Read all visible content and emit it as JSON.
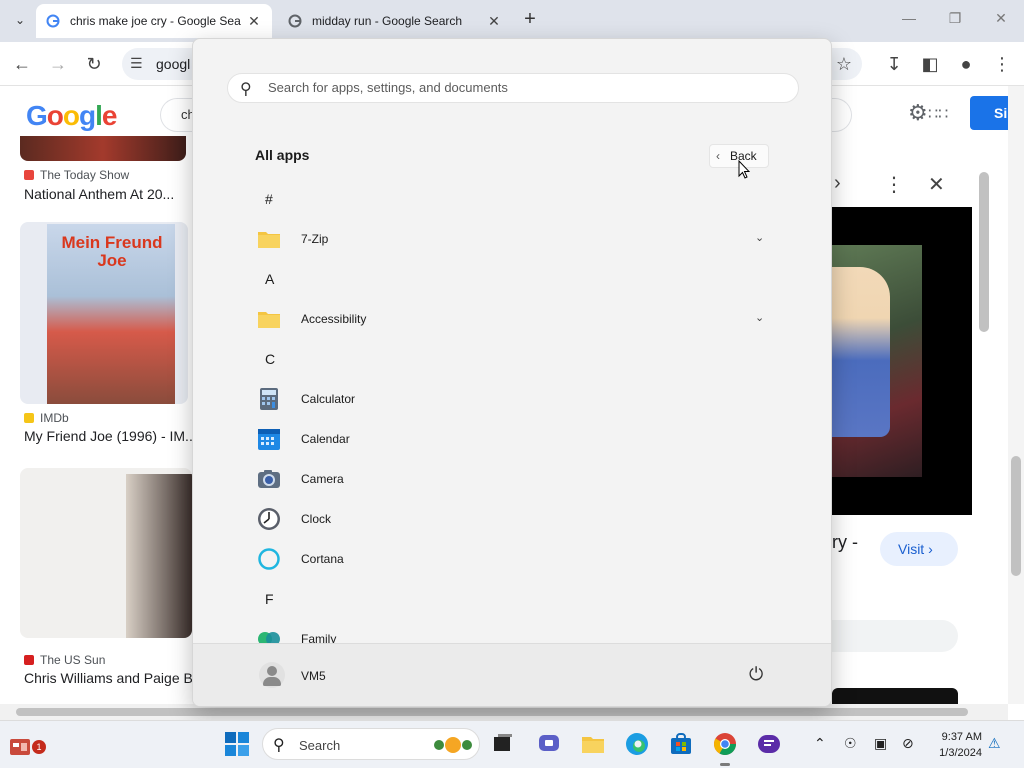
{
  "browser": {
    "tabs": [
      {
        "title": "chris make joe cry - Google Sea",
        "active": true
      },
      {
        "title": "midday run - Google Search",
        "active": false
      }
    ],
    "omnibox_text": "googl"
  },
  "google": {
    "logo": "Google",
    "query_visible": "ch",
    "signin_label": "Si",
    "results": [
      {
        "source": "The Today Show",
        "title": "National Anthem At 20..."
      },
      {
        "source": "IMDb",
        "title": "My Friend Joe (1996) - IM..."
      },
      {
        "source": "The US Sun",
        "title": "Chris Williams and Paige B"
      }
    ],
    "poster_text": "Mein Freund Joe",
    "panel_text": "ry -",
    "visit_label": "Visit"
  },
  "start_menu": {
    "search_placeholder": "Search for apps, settings, and documents",
    "title": "All apps",
    "back_label": "Back",
    "user_name": "VM5",
    "list": [
      {
        "kind": "letter",
        "label": "#"
      },
      {
        "kind": "app",
        "label": "7-Zip",
        "icon": "folder-icon",
        "expandable": true
      },
      {
        "kind": "letter",
        "label": "A"
      },
      {
        "kind": "app",
        "label": "Accessibility",
        "icon": "folder-icon",
        "expandable": true
      },
      {
        "kind": "letter",
        "label": "C"
      },
      {
        "kind": "app",
        "label": "Calculator",
        "icon": "calculator-icon"
      },
      {
        "kind": "app",
        "label": "Calendar",
        "icon": "calendar-icon"
      },
      {
        "kind": "app",
        "label": "Camera",
        "icon": "camera-icon"
      },
      {
        "kind": "app",
        "label": "Clock",
        "icon": "clock-icon"
      },
      {
        "kind": "app",
        "label": "Cortana",
        "icon": "cortana-icon"
      },
      {
        "kind": "letter",
        "label": "F"
      },
      {
        "kind": "app",
        "label": "Family",
        "icon": "family-icon"
      }
    ]
  },
  "taskbar": {
    "search_label": "Search",
    "time": "9:37 AM",
    "date": "1/3/2024",
    "widget_badge": "1"
  },
  "colors": {
    "accent": "#1a73e8",
    "folder": "#f4c542",
    "taskbar": "#eef1f6"
  }
}
